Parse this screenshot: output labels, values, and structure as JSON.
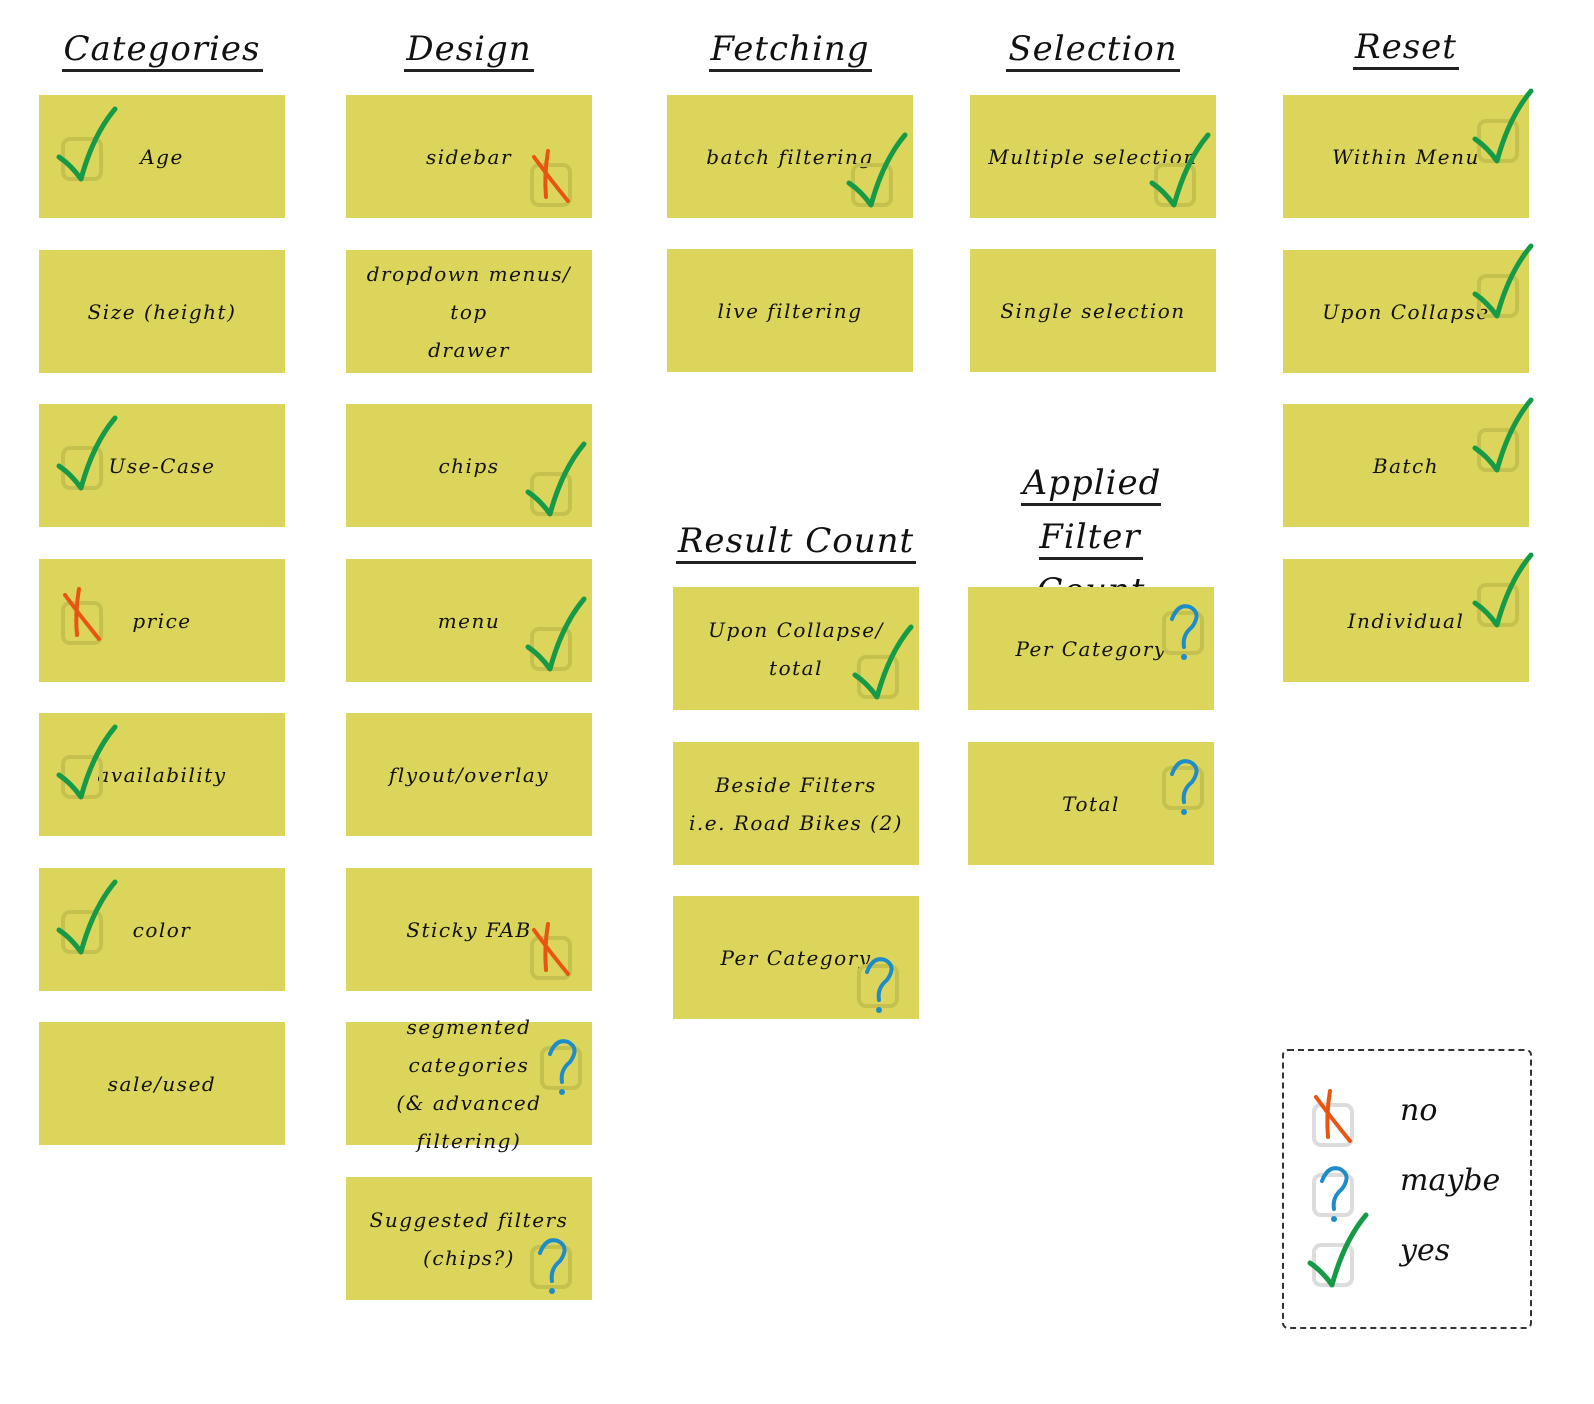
{
  "colors": {
    "card": "#dbd65b",
    "yes": "#169a48",
    "no": "#e85512",
    "maybe": "#1e8cc8",
    "box": "#c4c14e"
  },
  "columns": [
    {
      "heading": "Categories",
      "cards": [
        {
          "label": "Age",
          "mark": "yes"
        },
        {
          "label": "Size (height)",
          "mark": "none"
        },
        {
          "label": "Use-Case",
          "mark": "yes"
        },
        {
          "label": "price",
          "mark": "no"
        },
        {
          "label": "availability",
          "mark": "yes"
        },
        {
          "label": "color",
          "mark": "yes"
        },
        {
          "label": "sale/used",
          "mark": "none"
        }
      ]
    },
    {
      "heading": "Design",
      "cards": [
        {
          "label": "sidebar",
          "mark": "no"
        },
        {
          "label": "dropdown menus/ top\ndrawer",
          "mark": "none"
        },
        {
          "label": "chips",
          "mark": "yes"
        },
        {
          "label": "menu",
          "mark": "yes"
        },
        {
          "label": "flyout/overlay",
          "mark": "none"
        },
        {
          "label": "Sticky FAB",
          "mark": "no"
        },
        {
          "label": "segmented categories\n(& advanced filtering)",
          "mark": "maybe"
        },
        {
          "label": "Suggested filters\n(chips?)",
          "mark": "maybe"
        }
      ]
    },
    {
      "heading": "Fetching",
      "cards": [
        {
          "label": "batch filtering",
          "mark": "yes"
        },
        {
          "label": "live filtering",
          "mark": "none"
        }
      ]
    },
    {
      "heading": "Selection",
      "cards": [
        {
          "label": "Multiple selection",
          "mark": "yes"
        },
        {
          "label": "Single selection",
          "mark": "none"
        }
      ]
    },
    {
      "heading": "Reset",
      "cards": [
        {
          "label": "Within Menu",
          "mark": "yes"
        },
        {
          "label": "Upon Collapse",
          "mark": "yes"
        },
        {
          "label": "Batch",
          "mark": "yes"
        },
        {
          "label": "Individual",
          "mark": "yes"
        }
      ]
    },
    {
      "heading": "Result Count",
      "cards": [
        {
          "label": "Upon Collapse/ total",
          "mark": "yes"
        },
        {
          "label": "Beside Filters\ni.e. Road Bikes (2)",
          "mark": "none"
        },
        {
          "label": "Per Category",
          "mark": "maybe"
        }
      ]
    },
    {
      "heading": "Applied Filter\nCount",
      "cards": [
        {
          "label": "Per Category",
          "mark": "maybe"
        },
        {
          "label": "Total",
          "mark": "maybe"
        }
      ]
    }
  ],
  "legend": [
    {
      "mark": "no",
      "label": "no"
    },
    {
      "mark": "maybe",
      "label": "maybe"
    },
    {
      "mark": "yes",
      "label": "yes"
    }
  ]
}
